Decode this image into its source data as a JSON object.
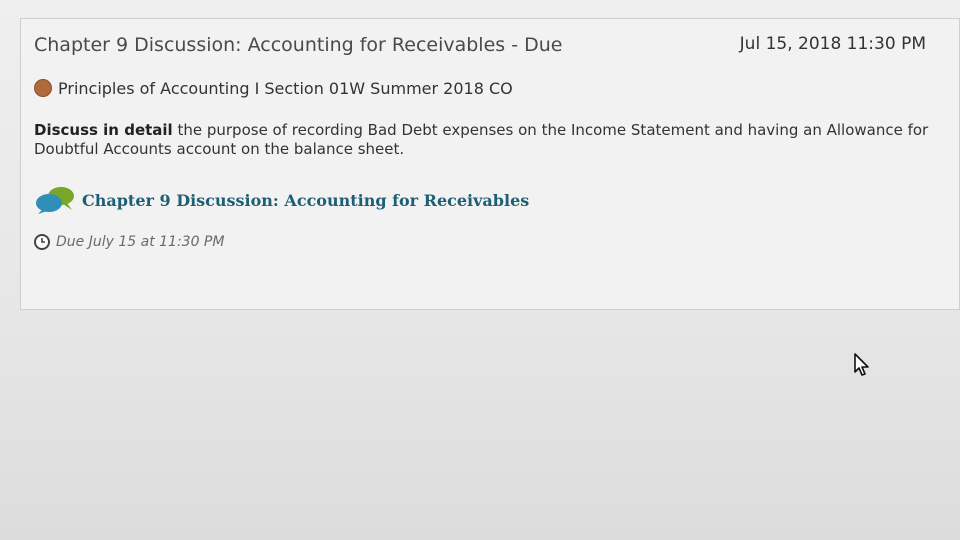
{
  "assignment": {
    "title": "Chapter 9 Discussion: Accounting for Receivables - Due",
    "due_datetime": "Jul 15, 2018 11:30 PM",
    "course": {
      "name": "Principles of Accounting I Section 01W Summer 2018 CO",
      "dot_color": "#b06a3c"
    },
    "description": {
      "bold_lead": "Discuss in detail",
      "text": " the purpose of recording Bad Debt expenses on the Income Statement and having an Allowance for Doubtful Accounts account on the balance sheet."
    },
    "discussion_link": {
      "label": "Chapter 9 Discussion: Accounting for Receivables",
      "icon": "discussion-bubbles-icon"
    },
    "due_note": {
      "icon": "clock-icon",
      "text": "Due July 15 at 11:30 PM"
    }
  },
  "colors": {
    "link": "#1f5f74",
    "card_background": "#f2f2f2"
  }
}
